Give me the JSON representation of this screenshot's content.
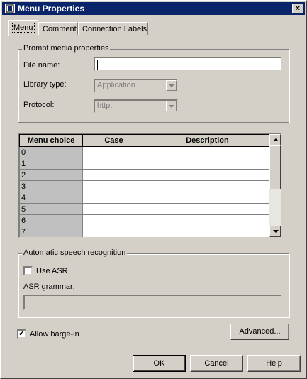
{
  "window": {
    "title": "Menu Properties",
    "close_label": "×"
  },
  "tabs": [
    {
      "label": "Menu",
      "active": true
    },
    {
      "label": "Comment",
      "active": false
    },
    {
      "label": "Connection Labels",
      "active": false
    }
  ],
  "prompt_group": {
    "title": "Prompt media properties",
    "file_name_label": "File name:",
    "file_name_value": "",
    "library_type_label": "Library type:",
    "library_type_value": "Application",
    "protocol_label": "Protocol:",
    "protocol_value": "http:"
  },
  "menu_table": {
    "headers": [
      "Menu choice",
      "Case",
      "Description"
    ],
    "rows": [
      [
        "0",
        "",
        ""
      ],
      [
        "1",
        "",
        ""
      ],
      [
        "2",
        "",
        ""
      ],
      [
        "3",
        "",
        ""
      ],
      [
        "4",
        "",
        ""
      ],
      [
        "5",
        "",
        ""
      ],
      [
        "6",
        "",
        ""
      ],
      [
        "7",
        "",
        ""
      ]
    ]
  },
  "asr_group": {
    "title": "Automatic speech recognition",
    "use_asr_label": "Use ASR",
    "use_asr_checked": false,
    "grammar_label": "ASR grammar:",
    "grammar_value": ""
  },
  "barge_in": {
    "label": "Allow barge-in",
    "checked": true,
    "check_mark": "✓"
  },
  "buttons": {
    "advanced": "Advanced...",
    "ok": "OK",
    "cancel": "Cancel",
    "help": "Help"
  }
}
